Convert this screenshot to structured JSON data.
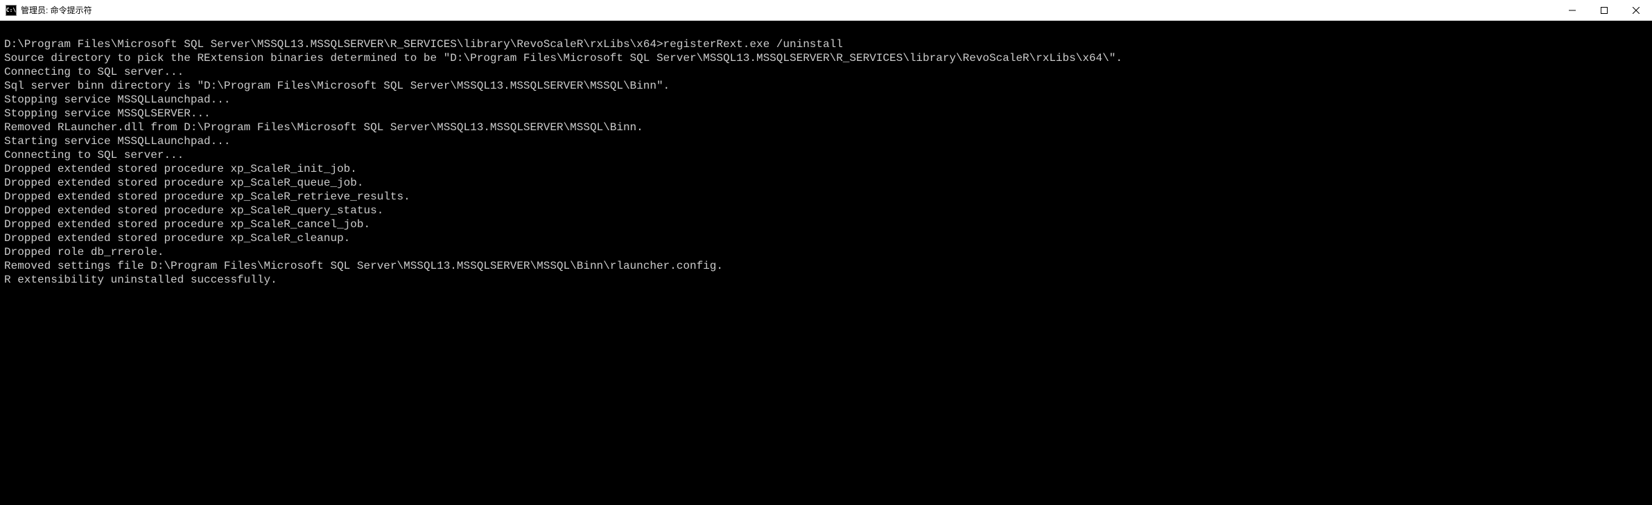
{
  "window": {
    "title": "管理员: 命令提示符",
    "icon_label": "C:\\"
  },
  "terminal": {
    "lines": [
      "",
      "D:\\Program Files\\Microsoft SQL Server\\MSSQL13.MSSQLSERVER\\R_SERVICES\\library\\RevoScaleR\\rxLibs\\x64>registerRext.exe /uninstall",
      "Source directory to pick the RExtension binaries determined to be \"D:\\Program Files\\Microsoft SQL Server\\MSSQL13.MSSQLSERVER\\R_SERVICES\\library\\RevoScaleR\\rxLibs\\x64\\\".",
      "Connecting to SQL server...",
      "Sql server binn directory is \"D:\\Program Files\\Microsoft SQL Server\\MSSQL13.MSSQLSERVER\\MSSQL\\Binn\".",
      "Stopping service MSSQLLaunchpad...",
      "Stopping service MSSQLSERVER...",
      "Removed RLauncher.dll from D:\\Program Files\\Microsoft SQL Server\\MSSQL13.MSSQLSERVER\\MSSQL\\Binn.",
      "Starting service MSSQLLaunchpad...",
      "Connecting to SQL server...",
      "Dropped extended stored procedure xp_ScaleR_init_job.",
      "Dropped extended stored procedure xp_ScaleR_queue_job.",
      "Dropped extended stored procedure xp_ScaleR_retrieve_results.",
      "Dropped extended stored procedure xp_ScaleR_query_status.",
      "Dropped extended stored procedure xp_ScaleR_cancel_job.",
      "Dropped extended stored procedure xp_ScaleR_cleanup.",
      "Dropped role db_rrerole.",
      "Removed settings file D:\\Program Files\\Microsoft SQL Server\\MSSQL13.MSSQLSERVER\\MSSQL\\Binn\\rlauncher.config.",
      "R extensibility uninstalled successfully."
    ]
  }
}
